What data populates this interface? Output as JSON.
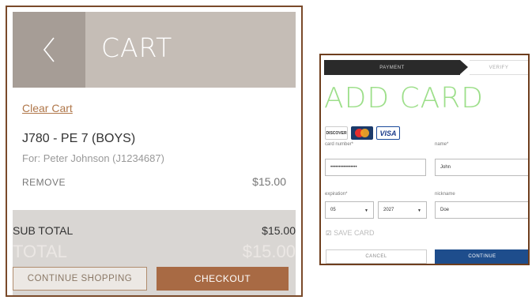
{
  "cart": {
    "title": "CART",
    "clear_cart": "Clear Cart",
    "item": {
      "title": "J780 - PE 7 (BOYS)",
      "for": "For: Peter Johnson (J1234687)",
      "remove": "REMOVE",
      "price": "$15.00"
    },
    "summary": {
      "subtotal_label": "SUB TOTAL",
      "subtotal_value": "$15.00",
      "total_label": "TOTAL",
      "total_value": "$15.00"
    },
    "continue_label": "CONTINUE SHOPPING",
    "checkout_label": "CHECKOUT"
  },
  "add_card": {
    "steps": {
      "payment": "PAYMENT",
      "verify": "VERIFY"
    },
    "title": "ADD CARD",
    "logos": {
      "discover": "DISCOVER",
      "visa": "VISA"
    },
    "card_number_label": "card number*",
    "card_number_value": "••••••••••••••••",
    "name_label": "name*",
    "name_value": "John",
    "expiration_label": "expiration*",
    "exp_month": "05",
    "exp_year": "2027",
    "nickname_label": "nickname",
    "nickname_value": "Doe",
    "save_card_label": "SAVE CARD",
    "cancel_label": "CANCEL",
    "continue_label": "CONTINUE"
  },
  "colors": {
    "header_bg": "#c5bdb6",
    "back_bg": "#a69d96",
    "accent_brown": "#a86a44",
    "add_card_green": "#9ddf8a",
    "continue_blue": "#1e4d8c"
  },
  "icons": {
    "back": "chevron-left-icon",
    "checkbox": "checkbox-checked-icon"
  }
}
